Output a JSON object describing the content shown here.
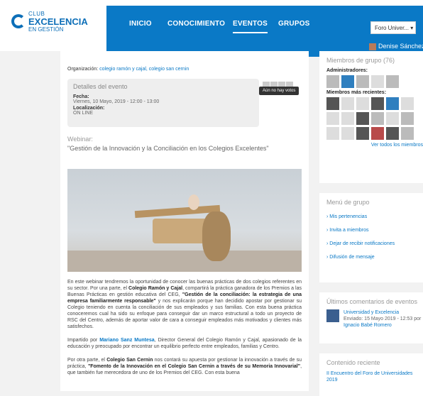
{
  "brand": {
    "line1": "CLUB",
    "line2": "EXCELENCIA",
    "line3": "EN GESTIÓN"
  },
  "nav": {
    "items": [
      "INICIO",
      "CONOCIMIENTO",
      "EVENTOS",
      "GRUPOS"
    ],
    "active": "EVENTOS",
    "foro_button": "Foro Univer...",
    "user": "Denise Sánchez"
  },
  "main": {
    "organization_label": "Organización:",
    "organization_links": "colegio ramón y cajal, colegio san cernin",
    "details_title": "Detalles del evento",
    "date_label": "Fecha:",
    "date_value": "Viernes, 10 Mayo, 2019 - 12:00 - 13:00",
    "location_label": "Localización:",
    "location_value": "ON LINE",
    "no_votes": "Aún no hay votos",
    "webinar_label": "Webinar:",
    "webinar_title": "\"Gestión de la Innovación y la Conciliación en los Colegios Excelentes\"",
    "p1_a": "En este webinar tendremos la oportunidad de conocer las buenas prácticas de dos colegios referentes en su sector. Por una parte, el ",
    "p1_b": "Colegio Ramón y Cajal",
    "p1_c": ", compartirá la práctica ganadora de los Premios a las Buenas Prácticas en gestión educativa del CEG, ",
    "p1_d": "\"Gestión de la conciliación: la estrategia de una empresa familiarmente responsable\"",
    "p1_e": " y nos explicarán porque han decidido apostar por gestionar su Colegio teniendo en cuenta la conciliación de sus empleados y sus familias. Con esta buena práctica conoceremos cual ha sido su enfoque para conseguir dar un marco estructural a todo un proyecto de RSC del Centro, además de aportar valor de cara a conseguir empleados más motivados y clientes más satisfechos.",
    "p2_a": "Impartido por ",
    "p2_b": "Mariano Sanz Muntesa",
    "p2_c": ", Director General del Colegio Ramón y Cajal, apasionado de la educación y preocupado por encontrar un equilibrio perfecto entre empleados, familias y Centro.",
    "p3_a": "Por otra parte, el ",
    "p3_b": "Colegio San Cernin",
    "p3_c": " nos contará su apuesta por gestionar la innovación a través de su práctica, ",
    "p3_d": "\"Fomento de la Innovación en el Colegio San Cernin a través de su Memoria Innovarial\"",
    "p3_e": ", que también fue merecedora de uno de los Premios del CEG. Con esta buena"
  },
  "sidebar": {
    "members_title": "Miembros de grupo (76)",
    "admins_label": "Administradores:",
    "recent_label": "Miembros más recientes:",
    "see_all": "Ver todos los miembros",
    "menu_title": "Menú de grupo",
    "menu_items": [
      "Mis pertenencias",
      "Invita a miembros",
      "Dejar de recibir notificaciones",
      "Difusión de mensaje"
    ],
    "comments_title": "Últimos comentarios de eventos",
    "comment_title": "Universidad y Excelencia",
    "comment_date": "Enviado: 15 Mayo 2019 - 12:53 por",
    "comment_author": "Ignacio Babé Romero",
    "recent_title": "Contenido reciente",
    "recent_item": "II Encuentro del Foro de Universidades 2019"
  }
}
